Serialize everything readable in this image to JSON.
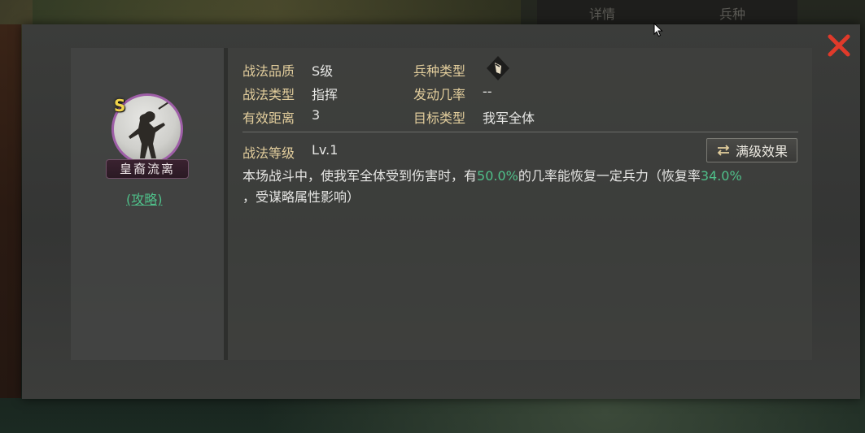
{
  "background": {
    "top_tabs": [
      "详情",
      "兵种"
    ],
    "left_text": "皇裔流离"
  },
  "hero": {
    "grade": "S",
    "name": "皇裔流离",
    "guide_link": "(攻略)"
  },
  "info": {
    "quality_label": "战法品质",
    "quality_value": "S级",
    "troop_type_label": "兵种类型",
    "tactic_type_label": "战法类型",
    "tactic_type_value": "指挥",
    "trigger_rate_label": "发动几率",
    "trigger_rate_value": "--",
    "range_label": "有效距离",
    "range_value": "3",
    "target_label": "目标类型",
    "target_value": "我军全体",
    "level_label": "战法等级",
    "level_value": "Lv.1",
    "max_level_button": "满级效果"
  },
  "description": {
    "part1": "本场战斗中，使我军全体受到伤害时，有",
    "rate": "50.0%",
    "part2": "的几率能恢复一定兵力（恢复率",
    "recovery": "34.0%",
    "part3": "，受谋略属性影响）"
  },
  "colors": {
    "label_gold": "#e2cd9c",
    "highlight_green": "#4fc08a",
    "close_red": "#e03a2a",
    "avatar_border": "#9e5ea7"
  },
  "icons": {
    "close": "close-icon",
    "troop": "troop-type-icon",
    "swap": "swap-icon"
  }
}
